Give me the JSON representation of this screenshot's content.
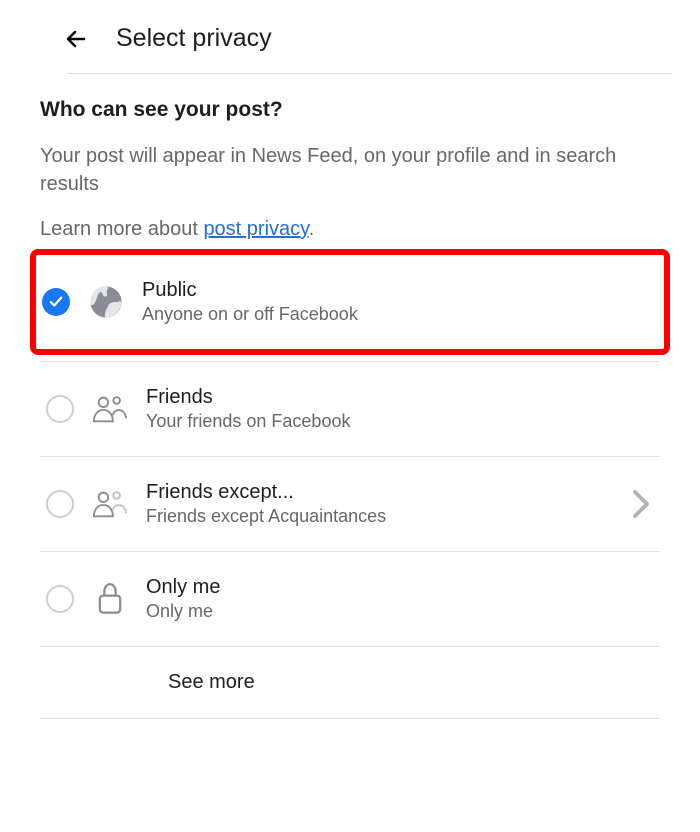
{
  "header": {
    "title": "Select privacy"
  },
  "heading": "Who can see your post?",
  "description": "Your post will appear in News Feed, on your profile and in search results",
  "learn_more_prefix": "Learn more about ",
  "learn_more_link": "post privacy",
  "learn_more_suffix": ".",
  "options": {
    "public": {
      "title": "Public",
      "sub": "Anyone on or off Facebook",
      "selected": true
    },
    "friends": {
      "title": "Friends",
      "sub": "Your friends on Facebook",
      "selected": false
    },
    "friends_except": {
      "title": "Friends except...",
      "sub": "Friends except Acquaintances",
      "selected": false
    },
    "only_me": {
      "title": "Only me",
      "sub": "Only me",
      "selected": false
    }
  },
  "see_more": "See more"
}
